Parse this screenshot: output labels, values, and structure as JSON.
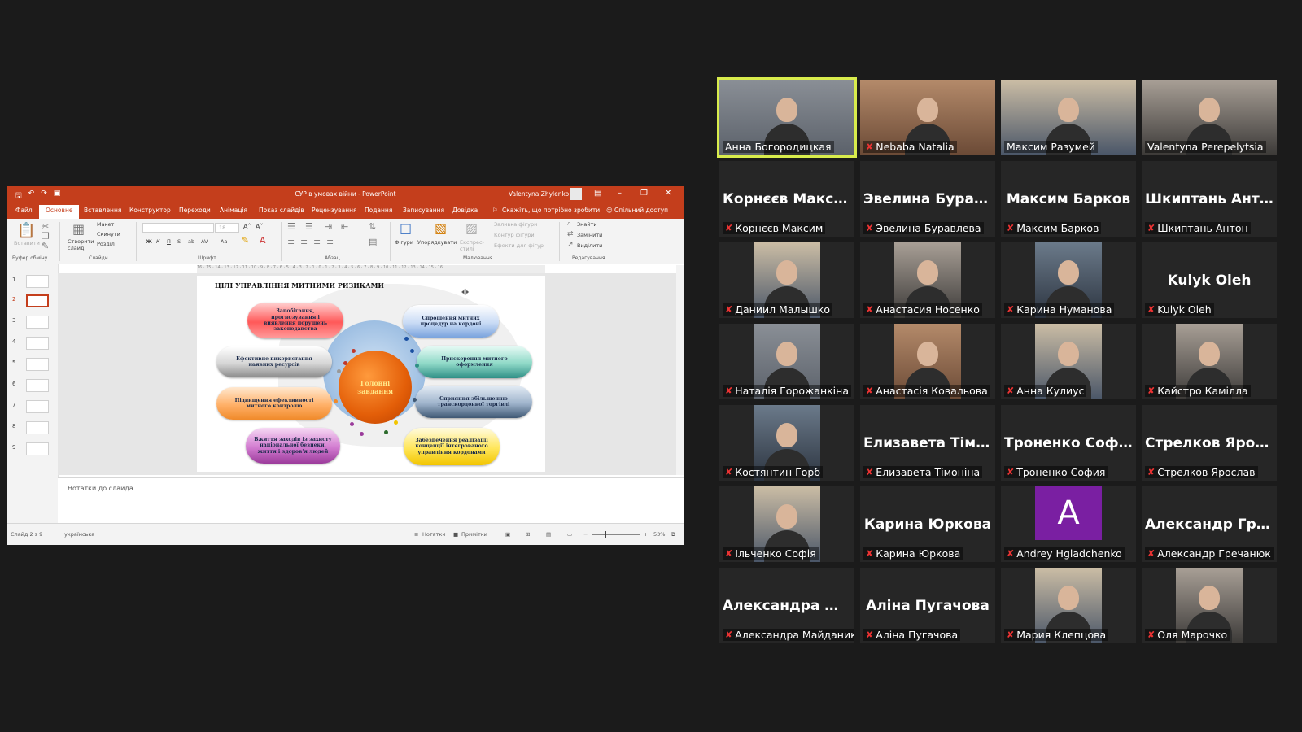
{
  "powerpoint": {
    "window_title": "СУР в умовах війни  -  PowerPoint",
    "user_name": "Valentyna Zhylenko",
    "tabs": [
      "Файл",
      "Основне",
      "Вставлення",
      "Конструктор",
      "Переходи",
      "Анімація",
      "Показ слайдів",
      "Рецензування",
      "Подання",
      "Записування",
      "Довідка"
    ],
    "tell_me": "Скажіть, що потрібно зробити",
    "share": "Спільний доступ",
    "ribbon": {
      "clipboard": {
        "paste": "Вставити",
        "group": "Буфер обміну"
      },
      "slides": {
        "new_slide": "Створити слайд",
        "layout": "Макет",
        "reset": "Скинути",
        "section": "Розділ",
        "group": "Слайди"
      },
      "font": {
        "size": "18",
        "group": "Шрифт",
        "bold": "Ж",
        "italic": "К",
        "underline": "П",
        "shadow": "S",
        "strike": "ab",
        "spacing": "AV",
        "case": "Aa"
      },
      "paragraph": {
        "group": "Абзац"
      },
      "drawing": {
        "shapes": "Фігури",
        "arrange": "Упорядкувати",
        "quick_styles": "Експрес-стилі",
        "fill": "Заливка фігури",
        "outline": "Контур фігури",
        "effects": "Ефекти для фігур",
        "group": "Малювання"
      },
      "editing": {
        "find": "Знайти",
        "replace": "Замінити",
        "select": "Виділити",
        "group": "Редагування"
      }
    },
    "ruler_text": "16 · 15 · 14 · 13 · 12 · 11 · 10 · 9 · 8 · 7 · 6 · 5 · 4 · 3 · 2 · 1 · 0 · 1 · 2 · 3 · 4 · 5 · 6 · 7 · 8 · 9 · 10 · 11 · 12 · 13 · 14 · 15 · 16",
    "thumbnails": [
      "1",
      "2",
      "3",
      "4",
      "5",
      "6",
      "7",
      "8",
      "9"
    ],
    "active_slide": "2",
    "slide": {
      "title": "ЦІЛІ УПРАВЛІННЯ МИТНИМИ РИЗИКАМИ",
      "center": "Головні завдання",
      "goals": [
        "Запобігання, прогнозування і виявлення порушень законодавства",
        "Спрощення митних процедур на кордоні",
        "Ефективне використання наявних ресурсів",
        "Прискорення митного оформлення",
        "Підвищення ефективності митного контролю",
        "Сприяння збільшенню транскордонної торгівлі",
        "Вжиття заходів із захисту національної безпеки, життя і здоров'я людей",
        "Забезпечення реалізації концепції інтегрованого управління кордонами"
      ]
    },
    "notes_placeholder": "Нотатки до слайда",
    "status": {
      "slide_counter": "Слайд 2 з 9",
      "language": "українська",
      "notes": "Нотатки",
      "comments": "Примітки",
      "zoom": "53%"
    }
  },
  "participants": [
    {
      "big_name": "",
      "name": "Анна Богородицкая",
      "muted": false,
      "video": true,
      "active": true
    },
    {
      "big_name": "",
      "name": "Nebaba Natalia",
      "muted": true,
      "video": true,
      "active": false
    },
    {
      "big_name": "",
      "name": "Максим Разумей",
      "muted": false,
      "video": true,
      "active": false
    },
    {
      "big_name": "",
      "name": "Valentyna Perepelytsia",
      "muted": false,
      "video": true,
      "active": false
    },
    {
      "big_name": "Корнєєв Максим",
      "name": "Корнєєв Максим",
      "muted": true,
      "video": false,
      "active": false
    },
    {
      "big_name": "Эвелина Бурав...",
      "name": "Эвелина Буравлева",
      "muted": true,
      "video": false,
      "active": false
    },
    {
      "big_name": "Максим Барков",
      "name": "Максим Барков",
      "muted": true,
      "video": false,
      "active": false
    },
    {
      "big_name": "Шкиптань Антон",
      "name": "Шкиптань Антон",
      "muted": true,
      "video": false,
      "active": false
    },
    {
      "big_name": "",
      "name": "Даниил Малышко",
      "muted": true,
      "video": true,
      "active": false
    },
    {
      "big_name": "",
      "name": "Анастасия Носенко",
      "muted": true,
      "video": true,
      "active": false
    },
    {
      "big_name": "",
      "name": "Карина Нуманова",
      "muted": true,
      "video": true,
      "active": false
    },
    {
      "big_name": "Kulyk Oleh",
      "name": "Kulyk Oleh",
      "muted": true,
      "video": false,
      "active": false
    },
    {
      "big_name": "",
      "name": "Наталія Горожанкіна",
      "muted": true,
      "video": true,
      "active": false
    },
    {
      "big_name": "",
      "name": "Анастасія Ковальова",
      "muted": true,
      "video": true,
      "active": false
    },
    {
      "big_name": "",
      "name": "Анна Кулиус",
      "muted": true,
      "video": true,
      "active": false
    },
    {
      "big_name": "",
      "name": "Кайстро Камілла",
      "muted": true,
      "video": true,
      "active": false
    },
    {
      "big_name": "",
      "name": "Костянтин Горб",
      "muted": true,
      "video": true,
      "active": false
    },
    {
      "big_name": "Елизавета Тімо...",
      "name": "Елизавета Тімоніна",
      "muted": true,
      "video": false,
      "active": false
    },
    {
      "big_name": "Троненко София",
      "name": "Троненко София",
      "muted": true,
      "video": false,
      "active": false
    },
    {
      "big_name": "Стрелков Ярос...",
      "name": "Стрелков Ярослав",
      "muted": true,
      "video": false,
      "active": false
    },
    {
      "big_name": "",
      "name": "Ільченко Софія",
      "muted": true,
      "video": true,
      "active": false
    },
    {
      "big_name": "Карина Юркова",
      "name": "Карина Юркова",
      "muted": true,
      "video": false,
      "active": false
    },
    {
      "big_name": "",
      "name": "Andrey Hgladchenko",
      "muted": true,
      "video": false,
      "avatar_letter": "A",
      "active": false
    },
    {
      "big_name": "Александр Гре...",
      "name": "Александр Гречанюк",
      "muted": true,
      "video": false,
      "active": false
    },
    {
      "big_name": "Александра Ма...",
      "name": "Александра Майданик",
      "muted": true,
      "video": false,
      "active": false
    },
    {
      "big_name": "Аліна Пугачова",
      "name": "Аліна Пугачова",
      "muted": true,
      "video": false,
      "active": false
    },
    {
      "big_name": "",
      "name": "Мария Клепцова",
      "muted": true,
      "video": true,
      "active": false
    },
    {
      "big_name": "",
      "name": "Оля Марочко",
      "muted": true,
      "video": true,
      "active": false
    }
  ],
  "colors": {
    "active_speaker": "#d8ec4c",
    "ppt_accent": "#c43e1c",
    "mic_muted": "#ee3333",
    "avatar_bg": "#7a1fa2"
  }
}
